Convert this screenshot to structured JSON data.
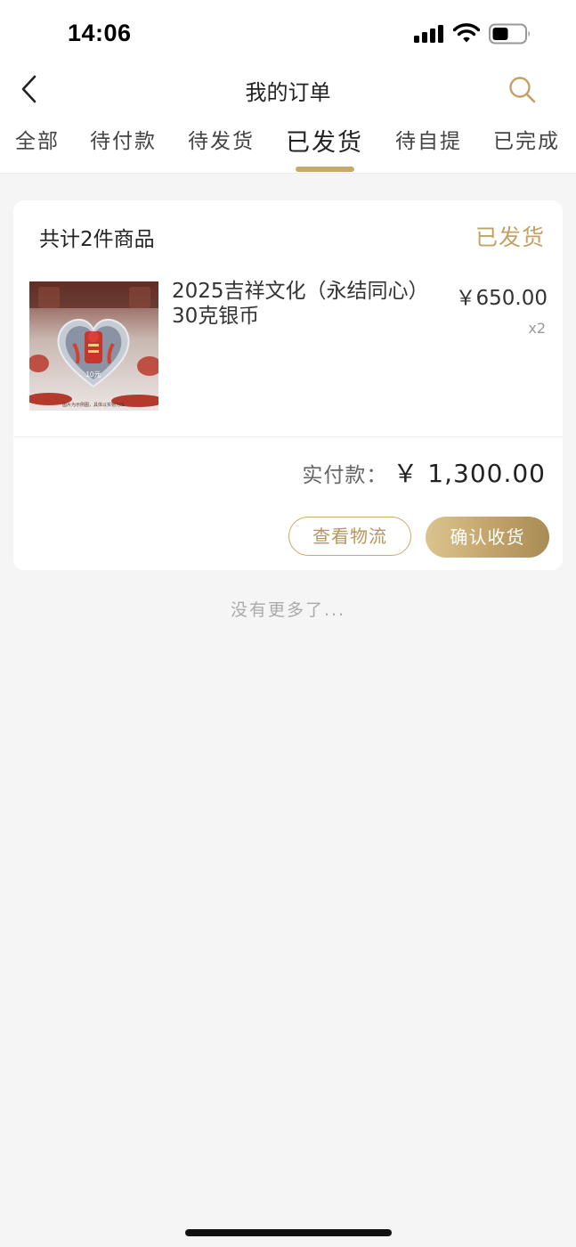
{
  "status_bar": {
    "time": "14:06"
  },
  "nav": {
    "title": "我的订单"
  },
  "tabs": [
    {
      "label": "全部"
    },
    {
      "label": "待付款"
    },
    {
      "label": "待发货"
    },
    {
      "label": "已发货",
      "active": true
    },
    {
      "label": "待自提"
    },
    {
      "label": "已完成"
    }
  ],
  "order": {
    "count_text": "共计2件商品",
    "status": "已发货",
    "product": {
      "name": "2025吉祥文化（永结同心）30克银币",
      "price": "￥650.00",
      "quantity": "x2",
      "image_caption": "图片为示例图，具体以实物为准"
    },
    "paid_label": "实付款：",
    "paid_value": "￥ 1,300.00",
    "buttons": {
      "logistics": "查看物流",
      "confirm": "确认收货"
    }
  },
  "footer": {
    "no_more": "没有更多了..."
  },
  "colors": {
    "accent_gold": "#c9a96a",
    "status_gold": "#c3a064",
    "background": "#f5f5f5",
    "card": "#ffffff"
  },
  "icons": [
    "back-icon",
    "search-icon",
    "signal-icon",
    "wifi-icon",
    "battery-icon"
  ]
}
